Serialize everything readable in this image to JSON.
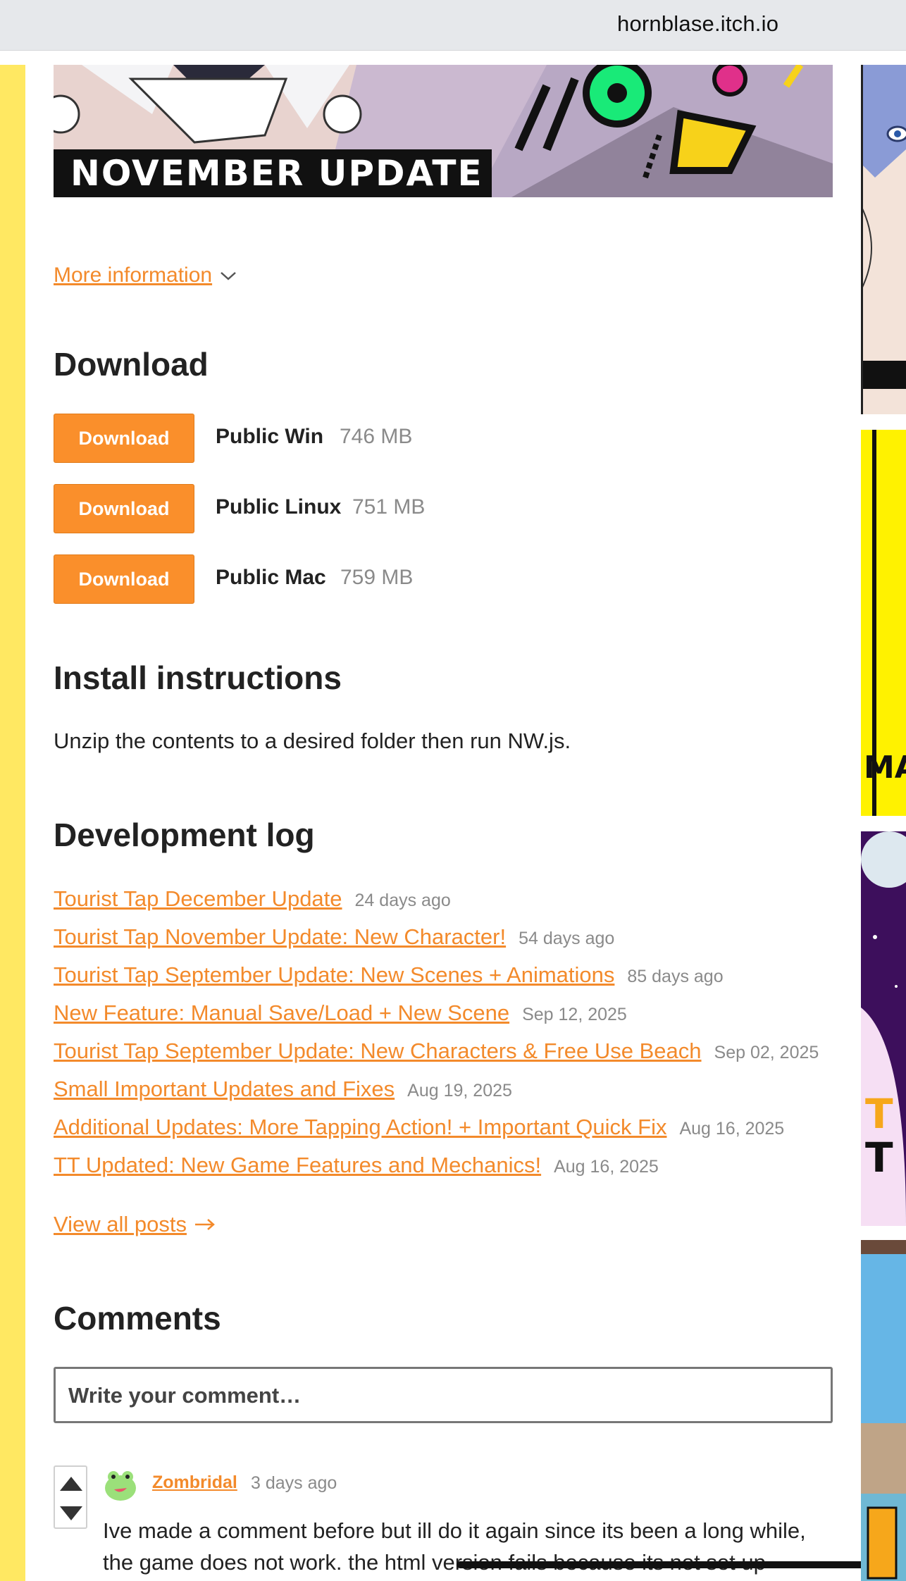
{
  "browser": {
    "url": "hornblase.itch.io"
  },
  "banner": {
    "caption": "NOVEMBER UPDATE"
  },
  "more_information": {
    "label": "More information"
  },
  "download": {
    "heading": "Download",
    "items": [
      {
        "button": "Download",
        "name": "Public Win",
        "size": "746 MB"
      },
      {
        "button": "Download",
        "name": "Public Linux",
        "size": "751 MB"
      },
      {
        "button": "Download",
        "name": "Public Mac",
        "size": "759 MB"
      }
    ]
  },
  "install": {
    "heading": "Install instructions",
    "text": "Unzip the contents to a desired folder then run NW.js."
  },
  "devlog": {
    "heading": "Development log",
    "posts": [
      {
        "title": "Tourist Tap December Update",
        "date": "24 days ago"
      },
      {
        "title": "Tourist Tap November Update: New Character!",
        "date": "54 days ago"
      },
      {
        "title": "Tourist Tap September Update: New Scenes + Animations",
        "date": "85 days ago"
      },
      {
        "title": "New Feature: Manual Save/Load + New Scene",
        "date": "Sep 12, 2025"
      },
      {
        "title": "Tourist Tap September Update: New Characters & Free Use Beach",
        "date": "Sep 02, 2025"
      },
      {
        "title": "Small Important Updates and Fixes",
        "date": "Aug 19, 2025"
      },
      {
        "title": "Additional Updates: More Tapping Action! + Important Quick Fix",
        "date": "Aug 16, 2025"
      },
      {
        "title": "TT Updated: New Game Features and Mechanics!",
        "date": "Aug 16, 2025"
      }
    ],
    "view_all": "View all posts"
  },
  "comments": {
    "heading": "Comments",
    "placeholder": "Write your comment…",
    "items": [
      {
        "author": "Zombridal",
        "date": "3 days ago",
        "body_line1": "Ive made a comment before but ill do it again since its been a long while,",
        "body_line2": "the game does not work. the html version fails because its not set up"
      }
    ]
  },
  "side_thumbs": {
    "text_ma": "MA",
    "text_t1": "T",
    "text_t2": "T"
  },
  "colors": {
    "accent": "#f38a2b",
    "button": "#fa8f2b",
    "left_strip": "#ffe862",
    "thumb_yellow": "#fff200"
  }
}
